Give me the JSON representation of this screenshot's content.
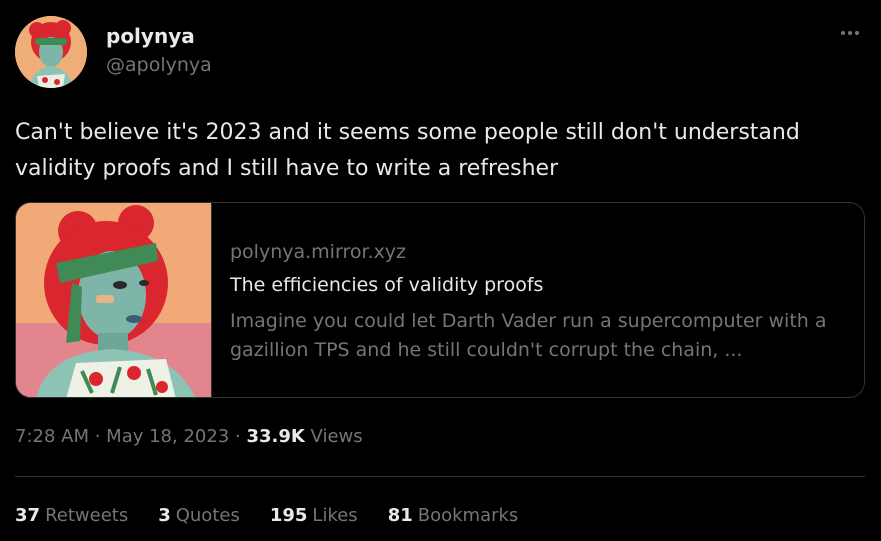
{
  "author": {
    "name": "polynya",
    "handle": "@apolynya"
  },
  "tweet": {
    "text": "Can't believe it's 2023 and it seems some people still don't understand validity proofs and I still have to write a refresher"
  },
  "card": {
    "domain": "polynya.mirror.xyz",
    "title": "The efficiencies of validity proofs",
    "description": "Imagine you could let Darth Vader run a supercomputer with a gazillion TPS and he still couldn't corrupt the chain, ..."
  },
  "meta": {
    "time": "7:28 AM",
    "separator1": " · ",
    "date": "May 18, 2023",
    "separator2": " · ",
    "views_count": "33.9K",
    "views_label": "Views"
  },
  "stats": {
    "retweets_count": "37",
    "retweets_label": "Retweets",
    "quotes_count": "3",
    "quotes_label": "Quotes",
    "likes_count": "195",
    "likes_label": "Likes",
    "bookmarks_count": "81",
    "bookmarks_label": "Bookmarks"
  },
  "icons": {
    "more": "more-horizontal-icon"
  },
  "colors": {
    "background": "#000000",
    "text_primary": "#e7e9ea",
    "text_secondary": "#71767b",
    "border": "#2f3336"
  }
}
